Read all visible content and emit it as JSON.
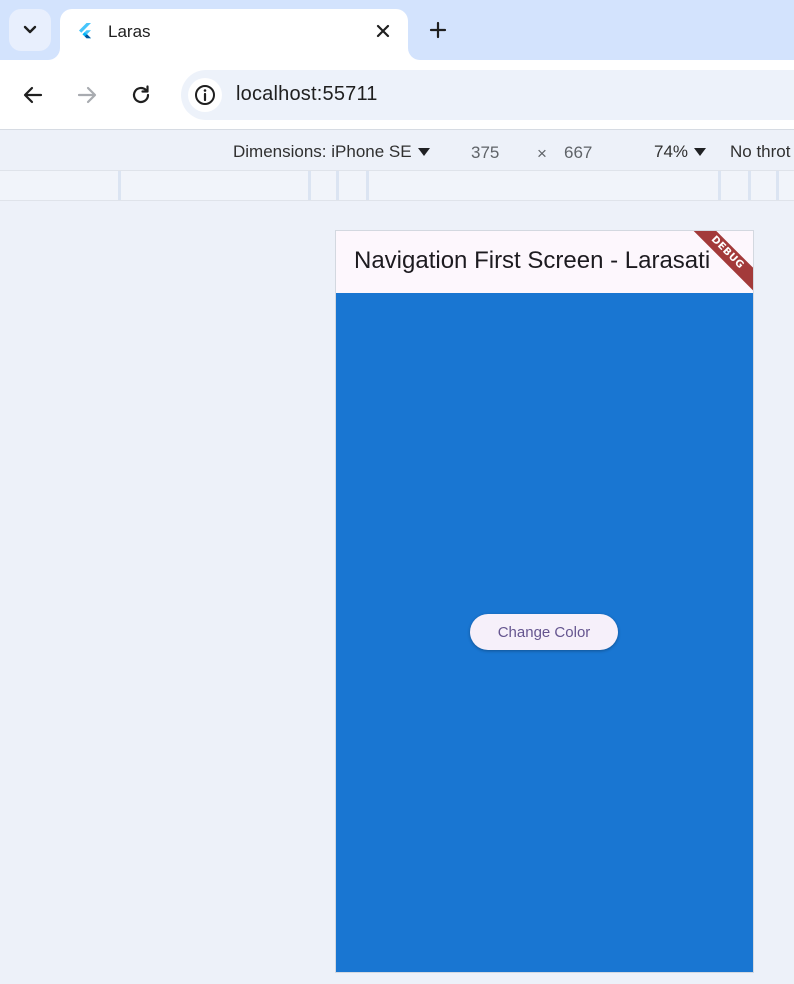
{
  "browser": {
    "tab": {
      "title": "Laras",
      "favicon": "flutter-logo-icon"
    },
    "omnibox": {
      "url": "localhost:55711"
    }
  },
  "devtools": {
    "dimensions_label": "Dimensions: iPhone SE",
    "width": "375",
    "times": "×",
    "height": "667",
    "zoom": "74%",
    "throttle": "No throt"
  },
  "app": {
    "appbar_title": "Navigation First Screen - Larasati",
    "debug_banner": "DEBUG",
    "button_label": "Change Color",
    "background_color": "#1976d2",
    "appbar_color": "#fdf7fd",
    "button_text_color": "#65558f"
  }
}
